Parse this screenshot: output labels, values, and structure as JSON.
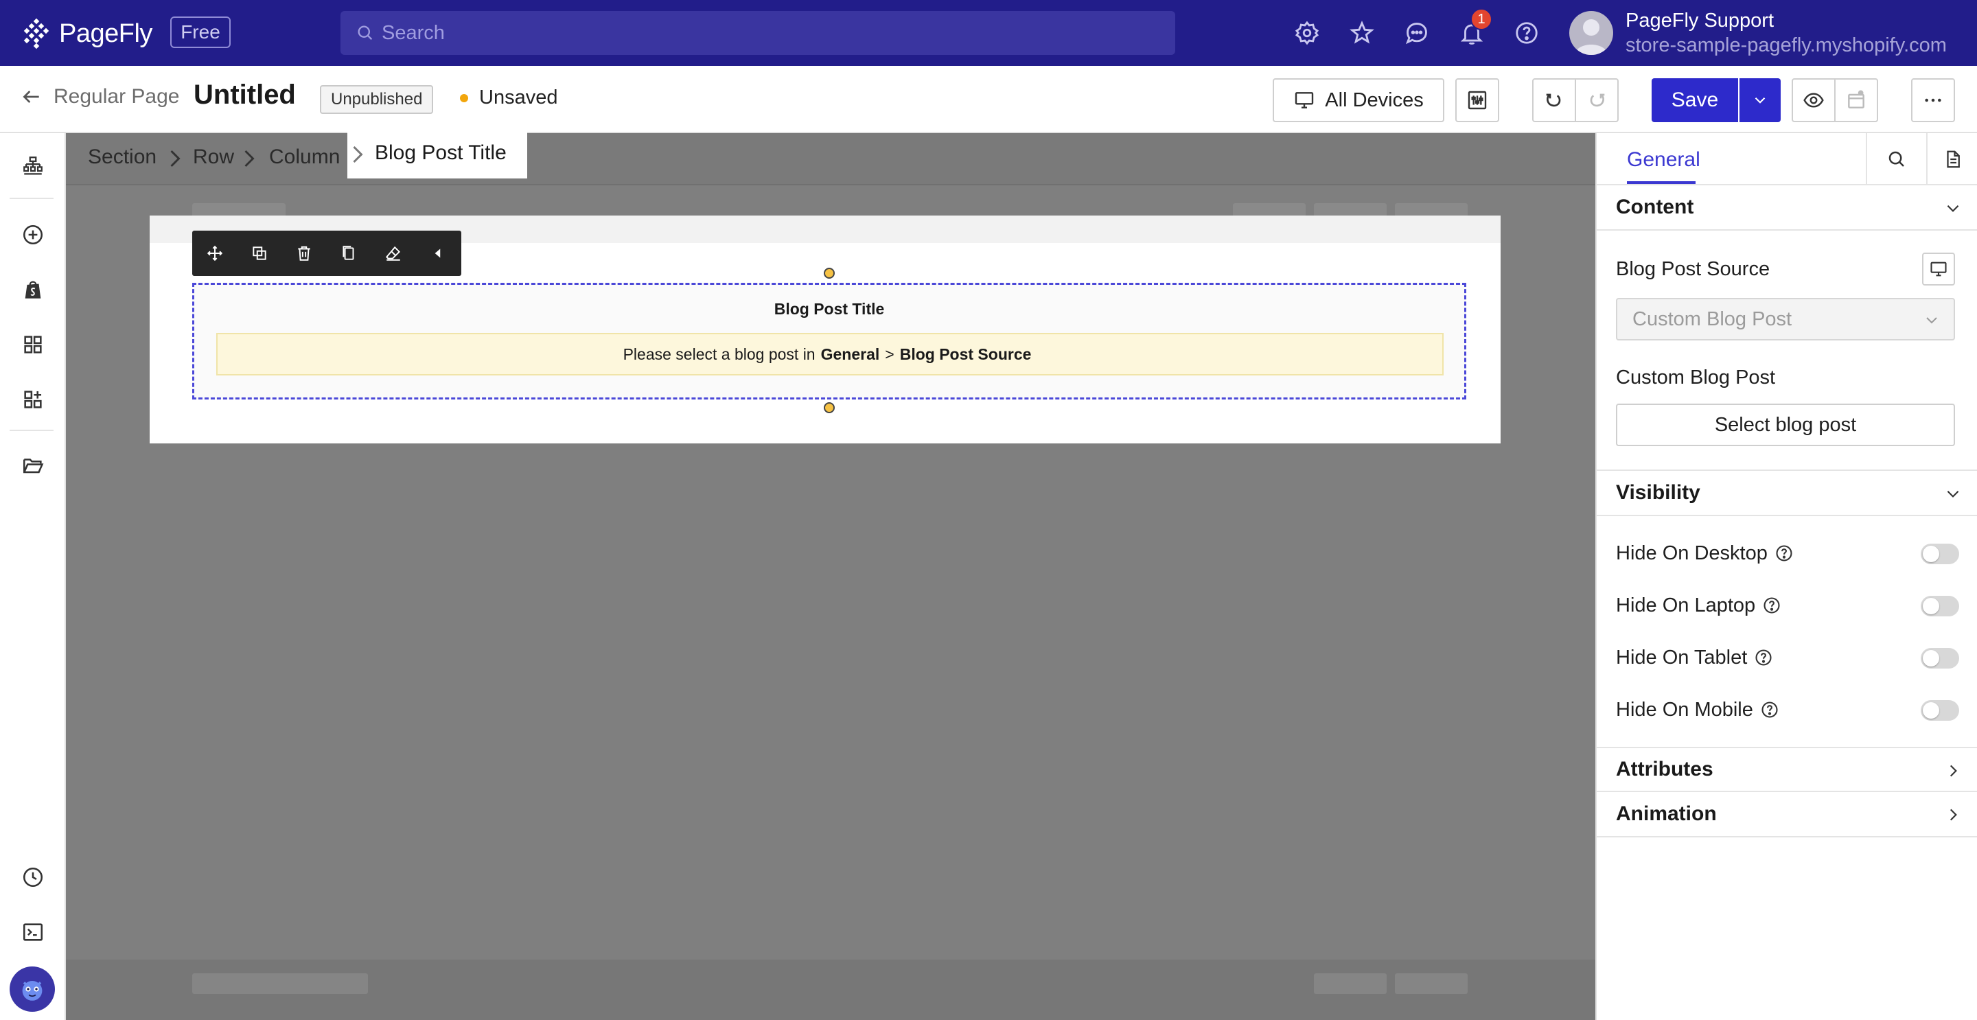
{
  "topbar": {
    "brand": "PageFly",
    "plan_badge": "Free",
    "search_placeholder": "Search",
    "notification_count": "1",
    "user": {
      "name": "PageFly Support",
      "store": "store-sample-pagefly.myshopify.com"
    }
  },
  "header": {
    "back_label": "Regular Page",
    "page_title": "Untitled",
    "publish_status": "Unpublished",
    "save_status": "Unsaved",
    "devices_label": "All Devices",
    "save_label": "Save"
  },
  "canvas": {
    "breadcrumb": [
      "Section",
      "Row",
      "Column",
      "Blog Post Title"
    ],
    "element_title": "Blog Post Title",
    "notice": {
      "prefix": "Please select a blog post in",
      "bold1": "General",
      "separator": ">",
      "bold2": "Blog Post Source"
    }
  },
  "panel": {
    "tab_general": "General",
    "sections": {
      "content": "Content",
      "visibility": "Visibility",
      "attributes": "Attributes",
      "animation": "Animation"
    },
    "blog_post_source_label": "Blog Post Source",
    "blog_post_source_value": "Custom Blog Post",
    "custom_blog_post_label": "Custom Blog Post",
    "select_blog_post_button": "Select blog post",
    "visibility_toggles": [
      {
        "label": "Hide On Desktop",
        "on": false
      },
      {
        "label": "Hide On Laptop",
        "on": false
      },
      {
        "label": "Hide On Tablet",
        "on": false
      },
      {
        "label": "Hide On Mobile",
        "on": false
      }
    ]
  },
  "colors": {
    "topbar_bg": "#221d8a",
    "accent": "#2d2acb",
    "tab_active": "#3b38d1",
    "unsaved_dot": "#f2a60c",
    "notification": "#e2452f",
    "selection_border": "#4b48d8",
    "notice_bg": "#fdf7dc"
  }
}
